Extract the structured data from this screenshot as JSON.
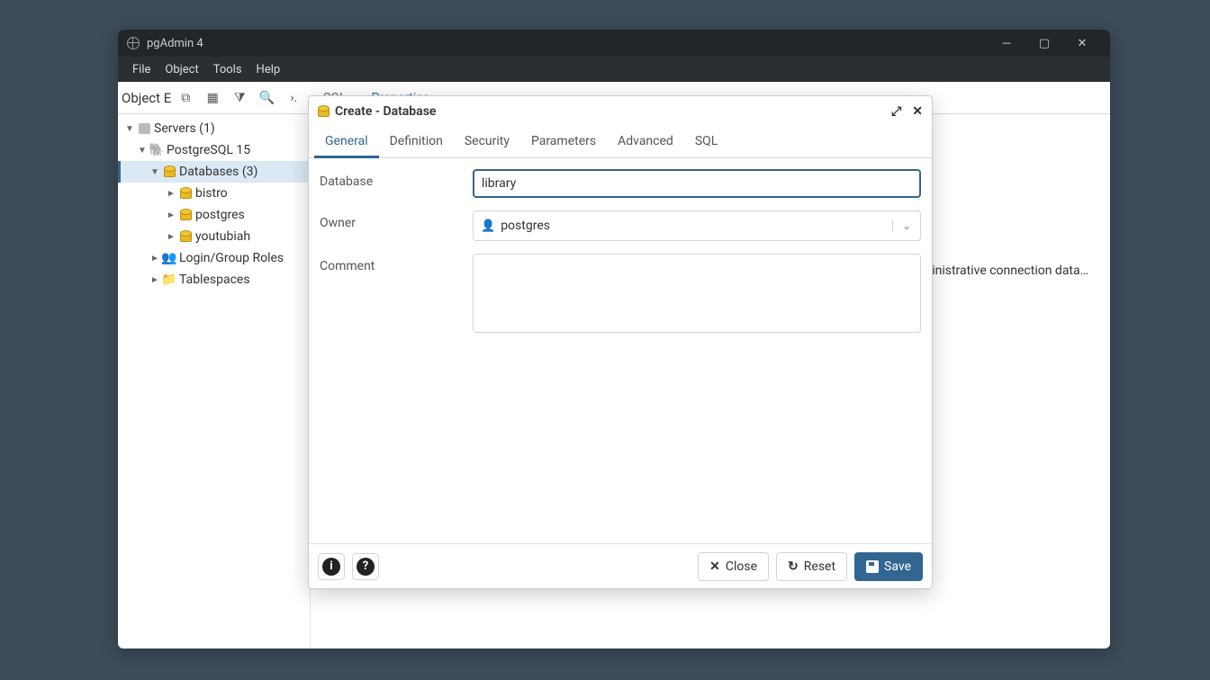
{
  "window": {
    "title": "pgAdmin 4"
  },
  "menu": [
    "File",
    "Object",
    "Tools",
    "Help"
  ],
  "toolbar": {
    "label": "Object E"
  },
  "main_tabs": {
    "sql": "SQL",
    "properties": "Properties"
  },
  "tree": {
    "servers": "Servers (1)",
    "pg": "PostgreSQL 15",
    "databases": "Databases (3)",
    "db_items": [
      "bistro",
      "postgres",
      "youtubiah"
    ],
    "login": "Login/Group Roles",
    "tablespaces": "Tablespaces"
  },
  "bg_hint": "ninistrative connection data…",
  "dialog": {
    "title": "Create - Database",
    "tabs": [
      "General",
      "Definition",
      "Security",
      "Parameters",
      "Advanced",
      "SQL"
    ],
    "fields": {
      "database": "Database",
      "owner": "Owner",
      "comment": "Comment"
    },
    "values": {
      "database": "library",
      "owner": "postgres"
    },
    "buttons": {
      "close": "Close",
      "reset": "Reset",
      "save": "Save"
    }
  }
}
